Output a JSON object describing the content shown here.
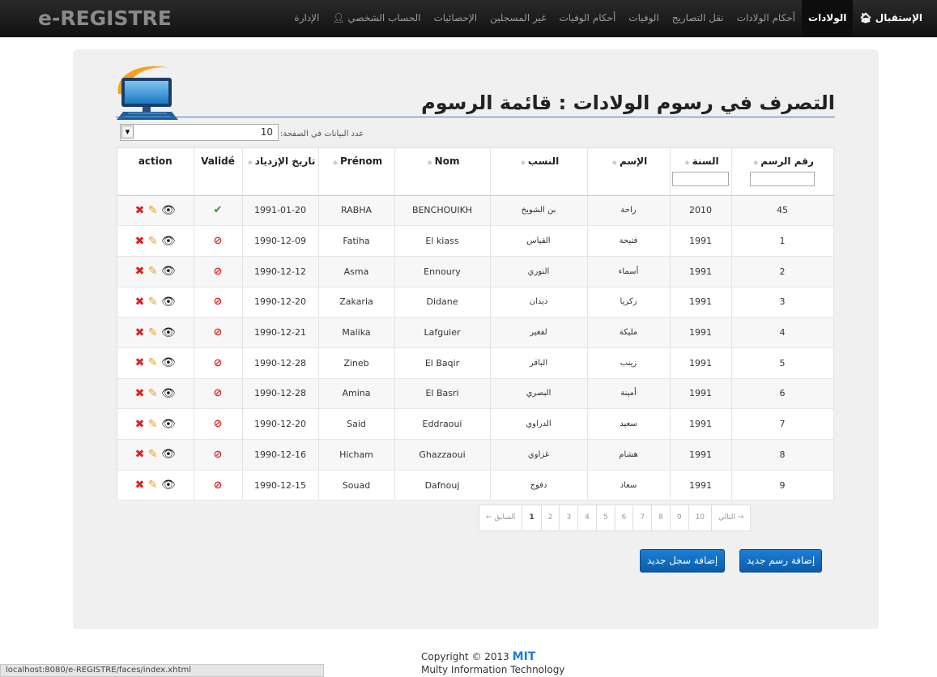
{
  "brand": "e-REGISTRE",
  "nav": {
    "home": "الإستقبال",
    "births": "الولادات",
    "birth_judgments": "أحكام الولادات",
    "transfer": "نقل التصاريح",
    "deaths": "الوفيات",
    "death_judgments": "أحكام الوفيات",
    "unregistered": "غير المسجلين",
    "statistics": "الإحصائيات",
    "account": "الحساب الشخصي",
    "admin": "الإدارة"
  },
  "page": {
    "title": "التصرف في رسوم الولادات : قائمة الرسوم"
  },
  "page_size": {
    "label": "عدد البيانات في الصفحة:",
    "value": "10"
  },
  "table": {
    "headers": {
      "fee_number": "رقم الرسم",
      "year": "السنة",
      "first_name_ar": "الإسم",
      "last_name_ar": "النسب",
      "nom": "Nom",
      "prenom": "Prénom",
      "birth_date": "تاريخ الإزدياد",
      "valide": "Validé",
      "action": "action"
    },
    "rows": [
      {
        "num": "45",
        "year": "2010",
        "prenom_ar": "راحة",
        "nom_ar": "بن الشويخ",
        "nom": "BENCHOUIKH",
        "prenom": "RABHA",
        "date": "1991-01-20",
        "valid": true
      },
      {
        "num": "1",
        "year": "1991",
        "prenom_ar": "فتيحة",
        "nom_ar": "القياس",
        "nom": "El kiass",
        "prenom": "Fatiha",
        "date": "1990-12-09",
        "valid": false
      },
      {
        "num": "2",
        "year": "1991",
        "prenom_ar": "أسماء",
        "nom_ar": "النوري",
        "nom": "Ennoury",
        "prenom": "Asma",
        "date": "1990-12-12",
        "valid": false
      },
      {
        "num": "3",
        "year": "1991",
        "prenom_ar": "زكريا",
        "nom_ar": "ديدان",
        "nom": "Didane",
        "prenom": "Zakaria",
        "date": "1990-12-20",
        "valid": false
      },
      {
        "num": "4",
        "year": "1991",
        "prenom_ar": "مليكة",
        "nom_ar": "لفغير",
        "nom": "Lafguier",
        "prenom": "Malika",
        "date": "1990-12-21",
        "valid": false
      },
      {
        "num": "5",
        "year": "1991",
        "prenom_ar": "زينب",
        "nom_ar": "الباقر",
        "nom": "El Baqir",
        "prenom": "Zineb",
        "date": "1990-12-28",
        "valid": false
      },
      {
        "num": "6",
        "year": "1991",
        "prenom_ar": "أمينة",
        "nom_ar": "البصري",
        "nom": "El Basri",
        "prenom": "Amina",
        "date": "1990-12-28",
        "valid": false
      },
      {
        "num": "7",
        "year": "1991",
        "prenom_ar": "سعيد",
        "nom_ar": "الدراوي",
        "nom": "Eddraoui",
        "prenom": "Said",
        "date": "1990-12-20",
        "valid": false
      },
      {
        "num": "8",
        "year": "1991",
        "prenom_ar": "هشام",
        "nom_ar": "غزاوي",
        "nom": "Ghazzaoui",
        "prenom": "Hicham",
        "date": "1990-12-16",
        "valid": false
      },
      {
        "num": "9",
        "year": "1991",
        "prenom_ar": "سعاد",
        "nom_ar": "دفوج",
        "nom": "Dafnouj",
        "prenom": "Souad",
        "date": "1990-12-15",
        "valid": false
      }
    ]
  },
  "pagination": {
    "prev": "← السابق",
    "pages": [
      "1",
      "2",
      "3",
      "4",
      "5",
      "6",
      "7",
      "8",
      "9",
      "10"
    ],
    "next": "التالي →"
  },
  "buttons": {
    "add_fee": "إضافة رسم جديد",
    "add_record": "إضافة سجل جديد"
  },
  "footer": {
    "copyright": "Copyright © 2013",
    "company_short": "MIT",
    "company_full": "Multy Information Technology"
  },
  "status_bar": "localhost:8080/e-REGISTRE/faces/index.xhtml",
  "colors": {
    "button": "#1a7fd8",
    "valid": "#2a9a2a",
    "invalid": "#e02020"
  }
}
